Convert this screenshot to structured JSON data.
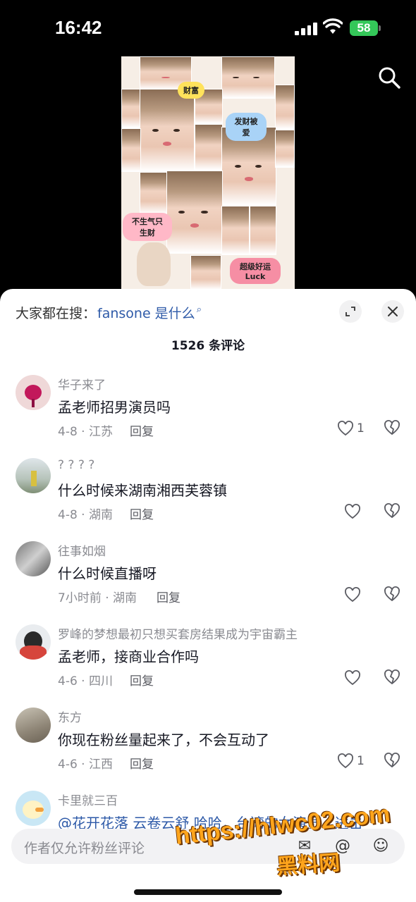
{
  "status_bar": {
    "time": "16:42",
    "battery": "58"
  },
  "video": {
    "stickers": [
      "财富",
      "发财被爱",
      "不生气只生财",
      "超级好运 Luck"
    ]
  },
  "sheet": {
    "search_prefix": "大家都在搜：",
    "search_term": "fansone 是什么",
    "comment_count": "1526 条评论",
    "reply_label": "回复",
    "comments": [
      {
        "user": "华子来了",
        "text": "孟老师招男演员吗",
        "meta": "4-8 · 江苏",
        "likes": "1"
      },
      {
        "user": "? ? ? ?",
        "text": "什么时候来湖南湘西芙蓉镇",
        "meta": "4-8 · 湖南",
        "likes": ""
      },
      {
        "user": "往事如烟",
        "text": "什么时候直播呀",
        "meta": "7小时前 · 湖南",
        "likes": ""
      },
      {
        "user": "罗峰的梦想最初只想买套房结果成为宇宙霸主",
        "text": "孟老师，接商业合作吗",
        "meta": "4-6 · 四川",
        "likes": ""
      },
      {
        "user": "东方",
        "text": "你现在粉丝量起来了，不会互动了",
        "meta": "4-6 · 江西",
        "likes": "1"
      },
      {
        "user": "卡里就三百",
        "text": "@花开花落 云卷云舒 哈哈，台湾的女演员，进击",
        "meta": "",
        "likes": ""
      }
    ]
  },
  "input": {
    "placeholder": "作者仅允许粉丝评论"
  },
  "watermark": {
    "url": "https://hlwc02.com",
    "name": "黑料网"
  },
  "colors": {
    "link": "#2e5aa8",
    "battery": "#34c759",
    "watermark": "#ffa51c"
  }
}
